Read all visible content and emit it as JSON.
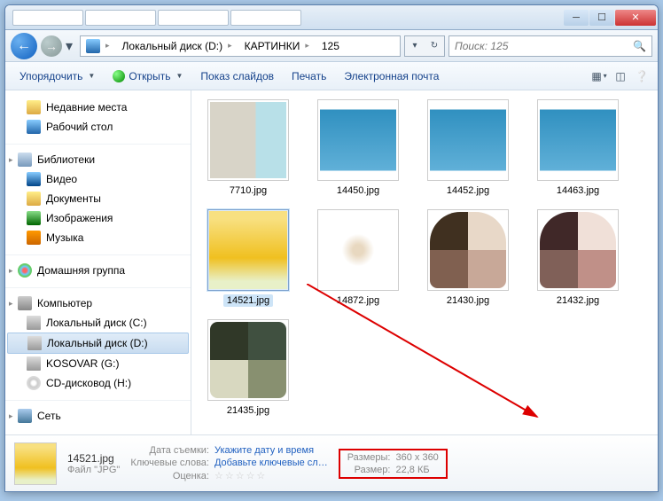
{
  "titlebar": {
    "tabs": [
      "",
      "",
      "",
      ""
    ]
  },
  "nav": {
    "crumbs": [
      "Локальный диск (D:)",
      "КАРТИНКИ",
      "125"
    ]
  },
  "search": {
    "placeholder": "Поиск: 125"
  },
  "toolbar": {
    "organize": "Упорядочить",
    "open": "Открыть",
    "slideshow": "Показ слайдов",
    "print": "Печать",
    "email": "Электронная почта"
  },
  "sidebar": {
    "recent": "Недавние места",
    "desktop": "Рабочий стол",
    "libraries": "Библиотеки",
    "video": "Видео",
    "documents": "Документы",
    "pictures": "Изображения",
    "music": "Музыка",
    "homegroup": "Домашняя группа",
    "computer": "Компьютер",
    "drive_c": "Локальный диск (C:)",
    "drive_d": "Локальный диск (D:)",
    "drive_g": "KOSOVAR (G:)",
    "drive_cd": "CD-дисковод (H:)",
    "network": "Сеть"
  },
  "files": [
    {
      "name": "7710.jpg",
      "cls": "th-echo"
    },
    {
      "name": "14450.jpg",
      "cls": "th-vblue"
    },
    {
      "name": "14452.jpg",
      "cls": "th-vblue"
    },
    {
      "name": "14463.jpg",
      "cls": "th-vblue"
    },
    {
      "name": "14521.jpg",
      "cls": "th-vyel",
      "selected": true
    },
    {
      "name": "14872.jpg",
      "cls": "th-tube"
    },
    {
      "name": "21430.jpg",
      "cls": "th-pal1"
    },
    {
      "name": "21432.jpg",
      "cls": "th-pal2"
    },
    {
      "name": "21435.jpg",
      "cls": "th-pal3"
    }
  ],
  "details": {
    "filename": "14521.jpg",
    "filetype": "Файл \"JPG\"",
    "date_label": "Дата съемки:",
    "date_val": "Укажите дату и время",
    "keywords_label": "Ключевые слова:",
    "keywords_val": "Добавьте ключевые сл…",
    "rating_label": "Оценка:",
    "dims_label": "Размеры:",
    "dims_val": "360 x 360",
    "size_label": "Размер:",
    "size_val": "22,8 КБ"
  }
}
